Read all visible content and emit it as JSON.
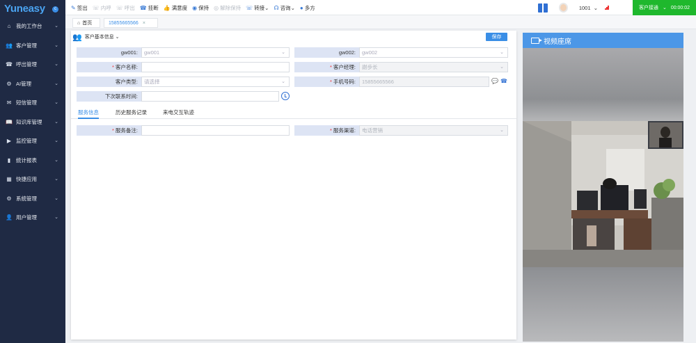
{
  "app": {
    "logo": "Yuneasy",
    "logo_badge": "c"
  },
  "sidebar": {
    "items": [
      {
        "icon": "home-icon",
        "glyph": "⌂",
        "label": "我的工作台"
      },
      {
        "icon": "users-icon",
        "glyph": "👥",
        "label": "客户管理"
      },
      {
        "icon": "phone-out-icon",
        "glyph": "☎",
        "label": "呼出管理"
      },
      {
        "icon": "robot-icon",
        "glyph": "⚙",
        "label": "AI管理"
      },
      {
        "icon": "mail-icon",
        "glyph": "✉",
        "label": "短信管理"
      },
      {
        "icon": "book-open-icon",
        "glyph": "📖",
        "label": "知识库管理"
      },
      {
        "icon": "monitor-icon",
        "glyph": "▶",
        "label": "监控管理"
      },
      {
        "icon": "bar-chart-icon",
        "glyph": "▮",
        "label": "统计报表"
      },
      {
        "icon": "apps-icon",
        "glyph": "▦",
        "label": "快捷应用"
      },
      {
        "icon": "gear-icon",
        "glyph": "⚙",
        "label": "系统管理"
      },
      {
        "icon": "user-icon",
        "glyph": "👤",
        "label": "用户管理"
      }
    ]
  },
  "toolbar": {
    "actions": [
      {
        "icon": "signout-icon",
        "glyph": "✎",
        "label": "签出",
        "enabled": true
      },
      {
        "icon": "internal-call-icon",
        "glyph": "☏",
        "label": "内呼",
        "enabled": false
      },
      {
        "icon": "outbound-call-icon",
        "glyph": "☏",
        "label": "呼出",
        "enabled": false
      },
      {
        "icon": "hangup-icon",
        "glyph": "☎",
        "label": "挂断",
        "enabled": true
      },
      {
        "icon": "satisfaction-icon",
        "glyph": "👍",
        "label": "满意度",
        "enabled": true
      },
      {
        "icon": "hold-icon",
        "glyph": "◉",
        "label": "保持",
        "enabled": true
      },
      {
        "icon": "unhold-icon",
        "glyph": "◎",
        "label": "解除保持",
        "enabled": false
      },
      {
        "icon": "transfer-icon",
        "glyph": "☏",
        "label": "转接",
        "enabled": true,
        "dropdown": true
      },
      {
        "icon": "consult-icon",
        "glyph": "☊",
        "label": "咨询",
        "enabled": true,
        "dropdown": true
      },
      {
        "icon": "conference-icon",
        "glyph": "●",
        "label": "多方",
        "enabled": true
      }
    ],
    "extension": "1001",
    "status_label": "客户接通",
    "timer": "00:00:02"
  },
  "tabs": {
    "home": "首页",
    "active": "15855665566"
  },
  "form": {
    "section_title": "客户基本信息",
    "save_label": "保存",
    "gw001": {
      "label": "gw001:",
      "value": "gw001"
    },
    "gw002": {
      "label": "gw002:",
      "value": "gw002"
    },
    "customer_name": {
      "label": "客户名称:",
      "value": ""
    },
    "customer_manager": {
      "label": "客户经理:",
      "value": "謝歩长"
    },
    "customer_type": {
      "label": "客户类型:",
      "value": "请选择"
    },
    "mobile": {
      "label": "手机号码:",
      "value": "15855665566"
    },
    "next_contact": {
      "label": "下次联系时间:",
      "value": ""
    }
  },
  "subtabs": [
    "服务信息",
    "历史服务记录",
    "来电交互轨迹"
  ],
  "service": {
    "remark": {
      "label": "服务备注:",
      "value": ""
    },
    "channel": {
      "label": "服务渠道:",
      "value": "电话营销"
    }
  },
  "video": {
    "title": "视频座席"
  }
}
